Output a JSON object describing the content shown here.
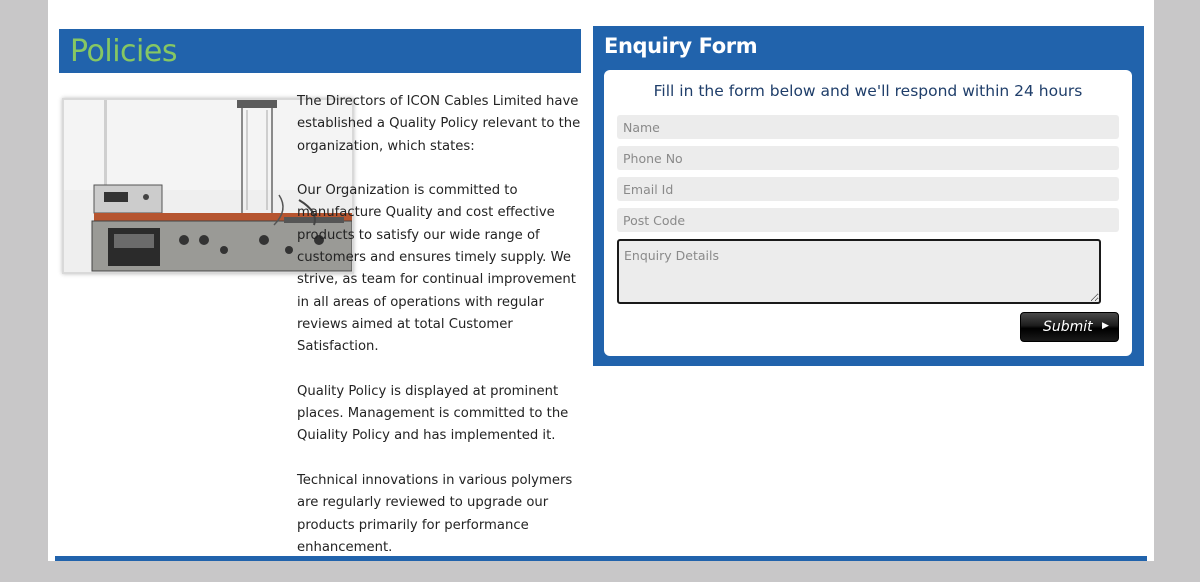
{
  "policies": {
    "title": "Policies",
    "photo_icon": "lab-equipment-photo",
    "paragraphs": [
      "The Directors of ICON Cables Limited have established a Quality Policy relevant to the organization, which states:",
      "Our Organization is committed to manufacture Quality and cost effective products to satisfy our wide range of customers and ensures timely supply. We strive, as team for continual improvement in all areas of operations with regular reviews aimed at total Customer Satisfaction.",
      "Quality Policy is displayed at prominent places. Management is committed to the Quiality Policy and has implemented it.",
      "Technical innovations in various polymers are regularly reviewed to upgrade our products primarily for performance enhancement."
    ]
  },
  "enquiry": {
    "title": "Enquiry Form",
    "intro": "Fill in the form below and we'll respond within 24 hours",
    "fields": {
      "name": {
        "placeholder": "Name",
        "value": ""
      },
      "phone": {
        "placeholder": "Phone No",
        "value": ""
      },
      "email": {
        "placeholder": "Email Id",
        "value": ""
      },
      "post_code": {
        "placeholder": "Post Code",
        "value": ""
      },
      "details": {
        "placeholder": "Enquiry Details",
        "value": ""
      }
    },
    "submit_label": "Submit",
    "submit_icon": "play-arrow-icon"
  },
  "colors": {
    "brand_blue": "#2163ac",
    "title_green": "#86c763",
    "page_bg": "#c8c7c8"
  }
}
